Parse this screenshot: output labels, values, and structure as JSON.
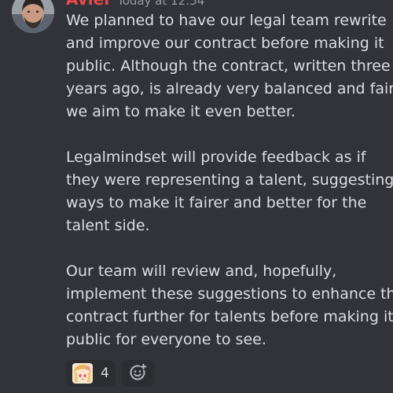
{
  "message": {
    "author": "Aviel",
    "timestamp": "Today at 12:54",
    "paragraphs": [
      [
        "We planned to have our legal team rewrite",
        "and improve our contract before making it",
        "public. Although the contract, written three",
        "years ago, is already very balanced and fair,",
        "we aim to make it even better."
      ],
      [
        "Legalmindset will provide feedback as if",
        "they were representing a talent, suggesting",
        "ways to make it fairer and better for the",
        "talent side."
      ],
      [
        "Our team will review and, hopefully,",
        "implement these suggestions to enhance the",
        "contract further for talents before making it",
        "public for everyone to see."
      ]
    ],
    "reactions": [
      {
        "emoji": "anime-character-emoji",
        "count": "4"
      }
    ],
    "add_reaction_icon": "add-reaction-icon"
  },
  "colors": {
    "background": "#313338",
    "username": "#f04747",
    "text": "#dbdee1",
    "muted": "#949ba4",
    "reaction_bg": "#2b2d31"
  }
}
